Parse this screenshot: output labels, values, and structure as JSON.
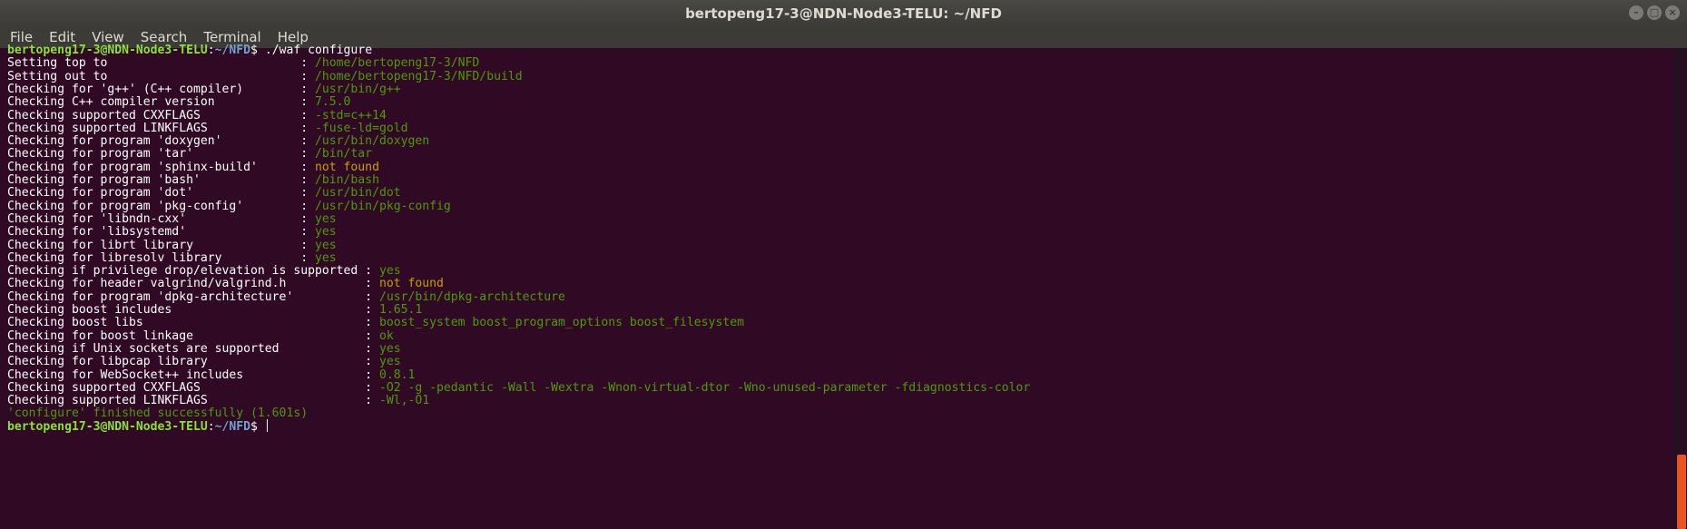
{
  "window": {
    "title": "bertopeng17-3@NDN-Node3-TELU: ~/NFD",
    "buttons": [
      "–",
      "□",
      "×"
    ]
  },
  "menu": [
    "File",
    "Edit",
    "View",
    "Search",
    "Terminal",
    "Help"
  ],
  "prompt": {
    "user": "bertopeng17-3@NDN-Node3-TELU",
    "sep": ":",
    "path": "~/NFD",
    "suffix": "$ ",
    "command": "./waf configure"
  },
  "lines": [
    {
      "msg": "Setting top to                           ",
      "sep": ": ",
      "value": "/home/bertopeng17-3/NFD",
      "color": "green"
    },
    {
      "msg": "Setting out to                           ",
      "sep": ": ",
      "value": "/home/bertopeng17-3/NFD/build",
      "color": "green"
    },
    {
      "msg": "Checking for 'g++' (C++ compiler)        ",
      "sep": ": ",
      "value": "/usr/bin/g++",
      "color": "green"
    },
    {
      "msg": "Checking C++ compiler version            ",
      "sep": ": ",
      "value": "7.5.0",
      "color": "green"
    },
    {
      "msg": "Checking supported CXXFLAGS              ",
      "sep": ": ",
      "value": "-std=c++14",
      "color": "green"
    },
    {
      "msg": "Checking supported LINKFLAGS             ",
      "sep": ": ",
      "value": "-fuse-ld=gold",
      "color": "green"
    },
    {
      "msg": "Checking for program 'doxygen'           ",
      "sep": ": ",
      "value": "/usr/bin/doxygen",
      "color": "green"
    },
    {
      "msg": "Checking for program 'tar'               ",
      "sep": ": ",
      "value": "/bin/tar",
      "color": "green"
    },
    {
      "msg": "Checking for program 'sphinx-build'      ",
      "sep": ": ",
      "value": "not found",
      "color": "orange"
    },
    {
      "msg": "Checking for program 'bash'              ",
      "sep": ": ",
      "value": "/bin/bash",
      "color": "green"
    },
    {
      "msg": "Checking for program 'dot'               ",
      "sep": ": ",
      "value": "/usr/bin/dot",
      "color": "green"
    },
    {
      "msg": "Checking for program 'pkg-config'        ",
      "sep": ": ",
      "value": "/usr/bin/pkg-config",
      "color": "green"
    },
    {
      "msg": "Checking for 'libndn-cxx'                ",
      "sep": ": ",
      "value": "yes",
      "color": "green"
    },
    {
      "msg": "Checking for 'libsystemd'                ",
      "sep": ": ",
      "value": "yes",
      "color": "green"
    },
    {
      "msg": "Checking for librt library               ",
      "sep": ": ",
      "value": "yes",
      "color": "green"
    },
    {
      "msg": "Checking for libresolv library           ",
      "sep": ": ",
      "value": "yes",
      "color": "green"
    },
    {
      "msg": "Checking if privilege drop/elevation is supported ",
      "sep": ": ",
      "value": "yes",
      "color": "green"
    },
    {
      "msg": "Checking for header valgrind/valgrind.h           ",
      "sep": ": ",
      "value": "not found",
      "color": "orange"
    },
    {
      "msg": "Checking for program 'dpkg-architecture'          ",
      "sep": ": ",
      "value": "/usr/bin/dpkg-architecture",
      "color": "green"
    },
    {
      "msg": "Checking boost includes                           ",
      "sep": ": ",
      "value": "1.65.1",
      "color": "green"
    },
    {
      "msg": "Checking boost libs                               ",
      "sep": ": ",
      "value": "boost_system boost_program_options boost_filesystem",
      "color": "green"
    },
    {
      "msg": "Checking for boost linkage                        ",
      "sep": ": ",
      "value": "ok",
      "color": "green"
    },
    {
      "msg": "Checking if Unix sockets are supported            ",
      "sep": ": ",
      "value": "yes",
      "color": "green"
    },
    {
      "msg": "Checking for libpcap library                      ",
      "sep": ": ",
      "value": "yes",
      "color": "green"
    },
    {
      "msg": "Checking for WebSocket++ includes                 ",
      "sep": ": ",
      "value": "0.8.1",
      "color": "green"
    },
    {
      "msg": "Checking supported CXXFLAGS                       ",
      "sep": ": ",
      "value": "-O2 -g -pedantic -Wall -Wextra -Wnon-virtual-dtor -Wno-unused-parameter -fdiagnostics-color",
      "color": "green"
    },
    {
      "msg": "Checking supported LINKFLAGS                      ",
      "sep": ": ",
      "value": "-Wl,-O1",
      "color": "green"
    }
  ],
  "finished": "'configure' finished successfully (1.601s)",
  "colors": {
    "background": "#300a24",
    "green": "#4e9a06",
    "orange": "#c4a000",
    "user": "#8ae234",
    "path": "#729fcf",
    "scroll_thumb": "#e95420"
  }
}
